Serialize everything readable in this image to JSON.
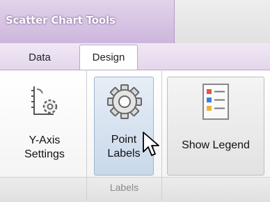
{
  "context_tab_group": {
    "title": "Scatter Chart Tools"
  },
  "tabs": [
    {
      "label": "Data",
      "selected": false
    },
    {
      "label": "Design",
      "selected": true
    }
  ],
  "ribbon": {
    "buttons": {
      "y_axis_settings": {
        "line1": "Y-Axis",
        "line2": "Settings",
        "icon": "y-axis-settings-icon"
      },
      "point_labels": {
        "line1": "Point",
        "line2": "Labels",
        "icon": "gear-icon",
        "state": "hovered"
      },
      "show_legend": {
        "label": "Show Legend",
        "icon": "legend-icon"
      }
    },
    "groups": [
      {
        "label": ""
      },
      {
        "label": "Labels"
      },
      {
        "label": ""
      }
    ]
  },
  "colors": {
    "context_purple": "#cdb6dc",
    "hover_blue": "#c9d8ea"
  }
}
